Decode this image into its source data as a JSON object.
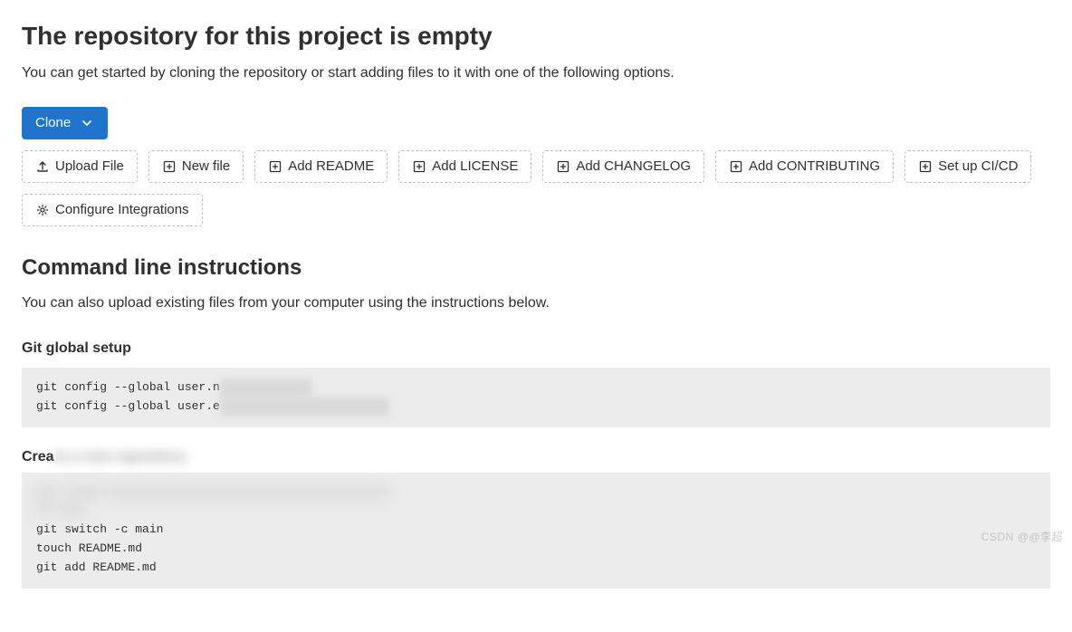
{
  "header": {
    "title": "The repository for this project is empty",
    "subtitle": "You can get started by cloning the repository or start adding files to it with one of the following options."
  },
  "actions": {
    "clone": "Clone",
    "upload_file": "Upload File",
    "new_file": "New file",
    "add_readme": "Add README",
    "add_license": "Add LICENSE",
    "add_changelog": "Add CHANGELOG",
    "add_contributing": "Add CONTRIBUTING",
    "setup_cicd": "Set up CI/CD",
    "configure_integrations": "Configure Integrations"
  },
  "cli": {
    "heading": "Command line instructions",
    "description": "You can also upload existing files from your computer using the instructions below."
  },
  "sections": {
    "global_setup": {
      "heading": "Git global setup",
      "code": "git config --global user.n\ngit config --global user.e"
    },
    "create_repo": {
      "heading_partial": "Crea",
      "code_visible": "git switch -c main\ntouch README.md\ngit add README.md"
    }
  },
  "watermark": "CSDN @@李超"
}
